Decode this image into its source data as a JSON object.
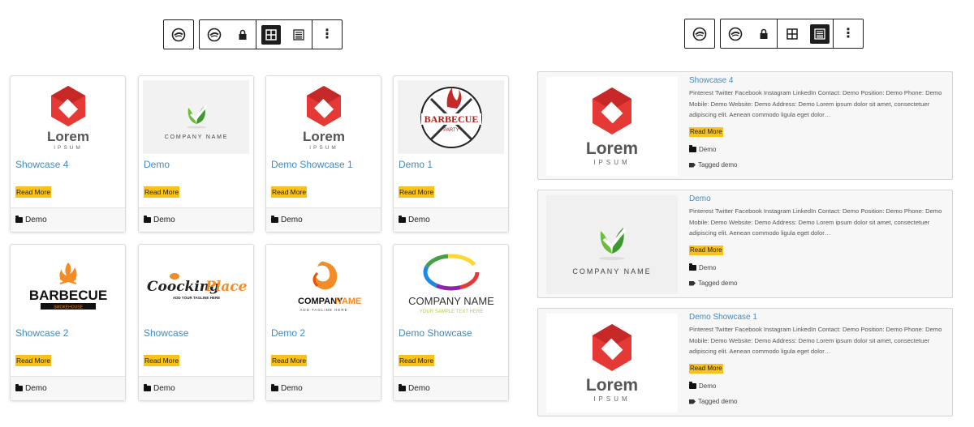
{
  "colors": {
    "accent": "#f9c11a",
    "link": "#3f8bc1",
    "toolbar_border": "#1e1e1e",
    "active": "#1e1e1e"
  },
  "toolbars": [
    {
      "name": "grid",
      "icons": [
        "block-type-icon",
        "block-type-icon",
        "lock-icon",
        "grid-view-icon",
        "list-view-icon",
        "more-options-icon"
      ],
      "active_view": "grid",
      "more_label": "⋮"
    },
    {
      "name": "list",
      "icons": [
        "block-type-icon",
        "block-type-icon",
        "lock-icon",
        "grid-view-icon",
        "list-view-icon",
        "more-options-icon"
      ],
      "active_view": "list",
      "more_label": "⋮"
    }
  ],
  "grid": {
    "read_more": "Read More",
    "cards": [
      {
        "title": "Showcase 4",
        "category": "Demo",
        "logo": "lorem-ipsum-logo"
      },
      {
        "title": "Demo",
        "category": "Demo",
        "logo": "company-name-leaf-logo"
      },
      {
        "title": "Demo Showcase 1",
        "category": "Demo",
        "logo": "lorem-ipsum-logo"
      },
      {
        "title": "Demo 1",
        "category": "Demo",
        "logo": "barbecue-party-logo"
      },
      {
        "title": "Showcase 2",
        "category": "Demo",
        "logo": "barbecue-smokehouse-logo"
      },
      {
        "title": "Showcase",
        "category": "Demo",
        "logo": "cooking-place-logo"
      },
      {
        "title": "Demo 2",
        "category": "Demo",
        "logo": "company-name-swirl-logo"
      },
      {
        "title": "Demo Showcase",
        "category": "Demo",
        "logo": "company-name-ring-logo"
      }
    ]
  },
  "list": {
    "read_more": "Read More",
    "rows": [
      {
        "title": "Showcase 4",
        "excerpt": "Pinterest Twitter Facebook Instagram LinkedIn Contact: Demo Position: Demo Phone: Demo Mobile: Demo Website: Demo Address: Demo Lorem ipsum dolor sit amet, consectetuer adipiscing elit. Aenean commodo ligula eget dolor…",
        "category": "Demo",
        "tags": "Tagged demo",
        "logo": "lorem-ipsum-logo"
      },
      {
        "title": "Demo",
        "excerpt": "Pinterest Twitter Facebook Instagram LinkedIn Contact: Demo Position: Demo Phone: Demo Mobile: Demo Website: Demo Address: Demo Lorem ipsum dolor sit amet, consectetuer adipiscing elit. Aenean commodo ligula eget dolor…",
        "category": "Demo",
        "tags": "Tagged demo",
        "logo": "company-name-leaf-logo"
      },
      {
        "title": "Demo Showcase 1",
        "excerpt": "Pinterest Twitter Facebook Instagram LinkedIn Contact: Demo Position: Demo Phone: Demo Mobile: Demo Website: Demo Address: Demo Lorem ipsum dolor sit amet, consectetuer adipiscing elit. Aenean commodo ligula eget dolor…",
        "category": "Demo",
        "tags": "Tagged demo",
        "logo": "lorem-ipsum-logo"
      }
    ]
  },
  "logos": {
    "lorem": {
      "word": "Lorem",
      "sub": "IPSUM"
    },
    "company_leaf": {
      "text": "COMPANY NAME"
    },
    "bbq_party": {
      "word": "BARBECUE",
      "sub": "PARTY"
    },
    "bbq_smoke": {
      "word": "BARBECUE",
      "sub": "SMOKEHOUSE"
    },
    "cooking": {
      "word1": "Coocking",
      "word2": "Place",
      "sub": "ADD YOUR TAGLINE HERE"
    },
    "company_swirl": {
      "word1": "COMPANY",
      "word2": "NAME",
      "sub": "ADD TAGLINE HERE"
    },
    "company_ring": {
      "text": "COMPANY NAME",
      "sub": "YOUR SAMPLE TEXT HERE"
    }
  }
}
